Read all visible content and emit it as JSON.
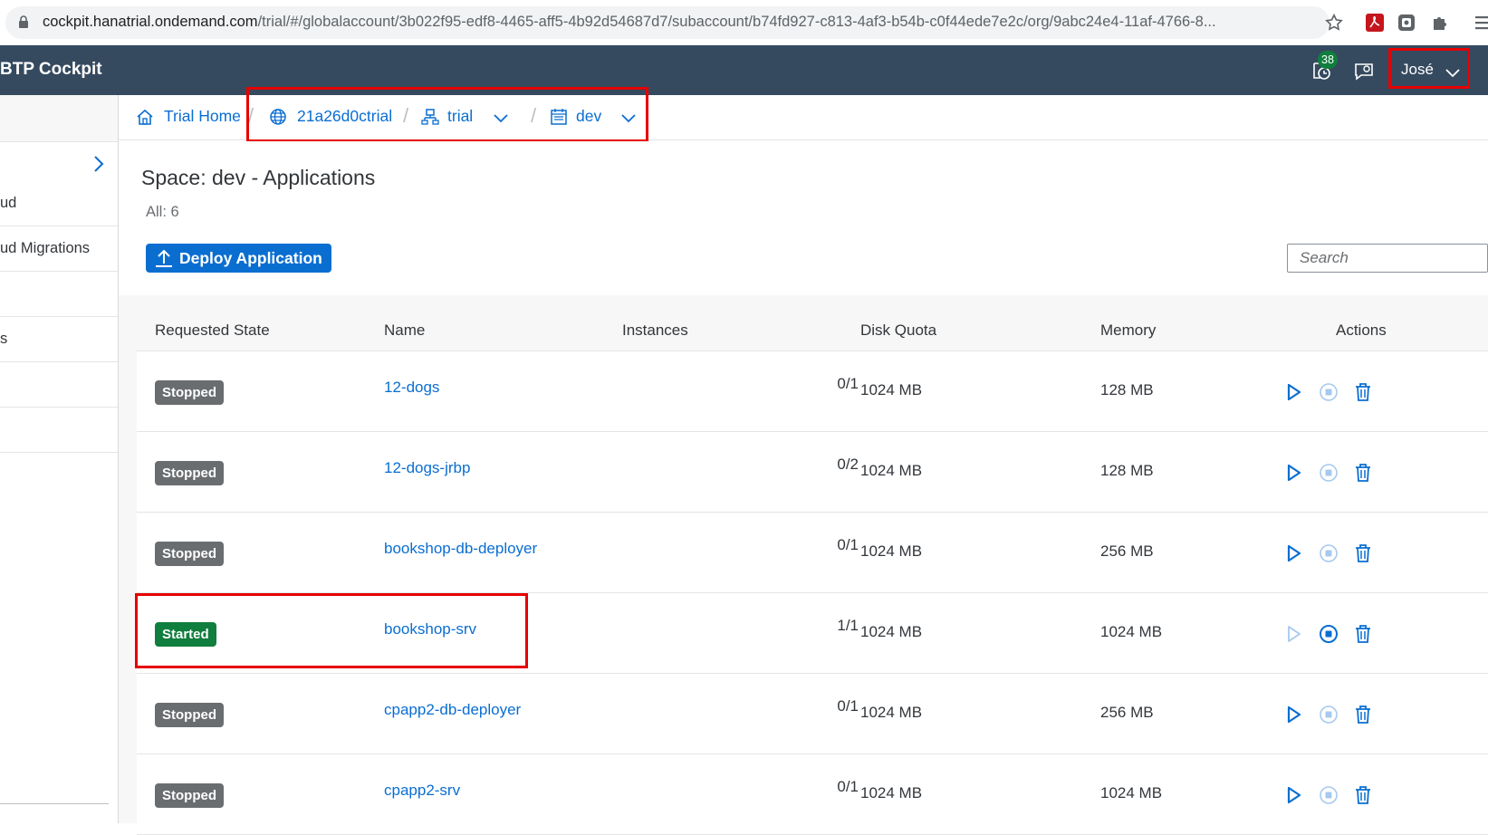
{
  "browser": {
    "url_host": "cockpit.hanatrial.ondemand.com",
    "url_path": "/trial/#/globalaccount/3b022f95-edf8-4465-aff5-4b92d54687d7/subaccount/b74fd927-c813-4af3-b54b-c0f44ede7e2c/org/9abc24e4-11af-4766-8..."
  },
  "shell": {
    "brand": "BTP Cockpit",
    "notification_count": "38",
    "user_name": "José"
  },
  "sidebar": {
    "items": [
      "ud",
      "ud Migrations",
      "",
      "s",
      "",
      ""
    ]
  },
  "breadcrumb": {
    "home": "Trial Home",
    "subaccount": "21a26d0ctrial",
    "org": "trial",
    "space": "dev",
    "separator": "/"
  },
  "page": {
    "title": "Space: dev - Applications",
    "count": "All: 6",
    "deploy_label": "Deploy Application",
    "search_placeholder": "Search"
  },
  "table": {
    "headers": [
      "Requested State",
      "Name",
      "Instances",
      "Disk Quota",
      "Memory",
      "Actions"
    ],
    "rows": [
      {
        "state": "Stopped",
        "name": "12-dogs",
        "instances": "0/1",
        "disk": "1024 MB",
        "memory": "128 MB"
      },
      {
        "state": "Stopped",
        "name": "12-dogs-jrbp",
        "instances": "0/2",
        "disk": "1024 MB",
        "memory": "128 MB"
      },
      {
        "state": "Stopped",
        "name": "bookshop-db-deployer",
        "instances": "0/1",
        "disk": "1024 MB",
        "memory": "256 MB"
      },
      {
        "state": "Started",
        "name": "bookshop-srv",
        "instances": "1/1",
        "disk": "1024 MB",
        "memory": "1024 MB"
      },
      {
        "state": "Stopped",
        "name": "cpapp2-db-deployer",
        "instances": "0/1",
        "disk": "1024 MB",
        "memory": "256 MB"
      },
      {
        "state": "Stopped",
        "name": "cpapp2-srv",
        "instances": "0/1",
        "disk": "1024 MB",
        "memory": "1024 MB"
      }
    ]
  },
  "colors": {
    "shell_bg": "#354a5f",
    "link": "#0a6ed1",
    "stopped": "#6a6d70",
    "started": "#107e3e",
    "highlight": "#e60000"
  },
  "icons": [
    "lock-icon",
    "star-icon",
    "pdf-extension-icon",
    "extension-icon",
    "puzzle-icon",
    "menu-icon",
    "notifications-icon",
    "feedback-icon",
    "chevron-down-icon",
    "home-icon",
    "globe-icon",
    "org-icon",
    "space-icon",
    "upload-icon",
    "play-icon",
    "stop-icon",
    "delete-icon"
  ]
}
